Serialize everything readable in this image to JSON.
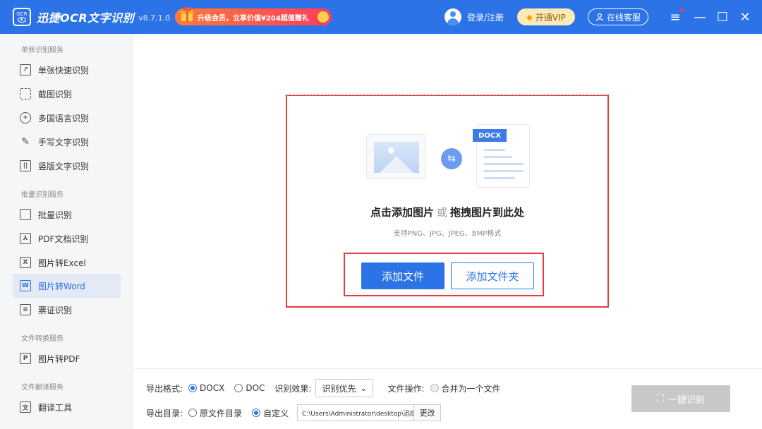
{
  "titlebar": {
    "logo_text": "OCR",
    "app_name": "迅捷OCR文字识别",
    "version": "v8.7.1.0",
    "promo": "升级会员，立享价值¥204超值赠礼",
    "login": "登录/注册",
    "vip": "开通VIP",
    "service": "在线客服"
  },
  "sidebar": {
    "sections": [
      {
        "title": "单张识别服务",
        "items": [
          {
            "label": "单张快速识别",
            "icon": "edit-image-icon"
          },
          {
            "label": "截图识别",
            "icon": "crop-icon"
          },
          {
            "label": "多国语言识别",
            "icon": "globe-icon"
          },
          {
            "label": "手写文字识别",
            "icon": "pen-icon"
          },
          {
            "label": "竖版文字识别",
            "icon": "vertical-text-icon"
          }
        ]
      },
      {
        "title": "批量识别服务",
        "items": [
          {
            "label": "批量识别",
            "icon": "batch-icon"
          },
          {
            "label": "PDF文档识别",
            "icon": "pdf-icon"
          },
          {
            "label": "图片转Excel",
            "icon": "excel-icon"
          },
          {
            "label": "图片转Word",
            "icon": "word-icon"
          },
          {
            "label": "票证识别",
            "icon": "ticket-icon"
          }
        ]
      },
      {
        "title": "文件转换服务",
        "items": [
          {
            "label": "图片转PDF",
            "icon": "pdf-convert-icon"
          }
        ]
      },
      {
        "title": "文件翻译服务",
        "items": [
          {
            "label": "翻译工具",
            "icon": "translate-icon"
          }
        ]
      }
    ],
    "active_label": "图片转Word"
  },
  "dropzone": {
    "doc_tag": "DOCX",
    "title_a": "点击添加图片",
    "title_or": "或",
    "title_b": "拖拽图片到此处",
    "subtitle": "支持PNG、JPG、JPEG、BMP格式",
    "add_file": "添加文件",
    "add_folder": "添加文件夹"
  },
  "bottom": {
    "format_label": "导出格式:",
    "format_docx": "DOCX",
    "format_doc": "DOC",
    "effect_label": "识别效果:",
    "effect_value": "识别优先",
    "fileop_label": "文件操作:",
    "fileop_merge": "合并为一个文件",
    "dir_label": "导出目录:",
    "dir_original": "原文件目录",
    "dir_custom": "自定义",
    "path": "C:\\Users\\Administrator\\desktop\\迅捷OCR文",
    "change": "更改",
    "recognize": "一键识别"
  }
}
